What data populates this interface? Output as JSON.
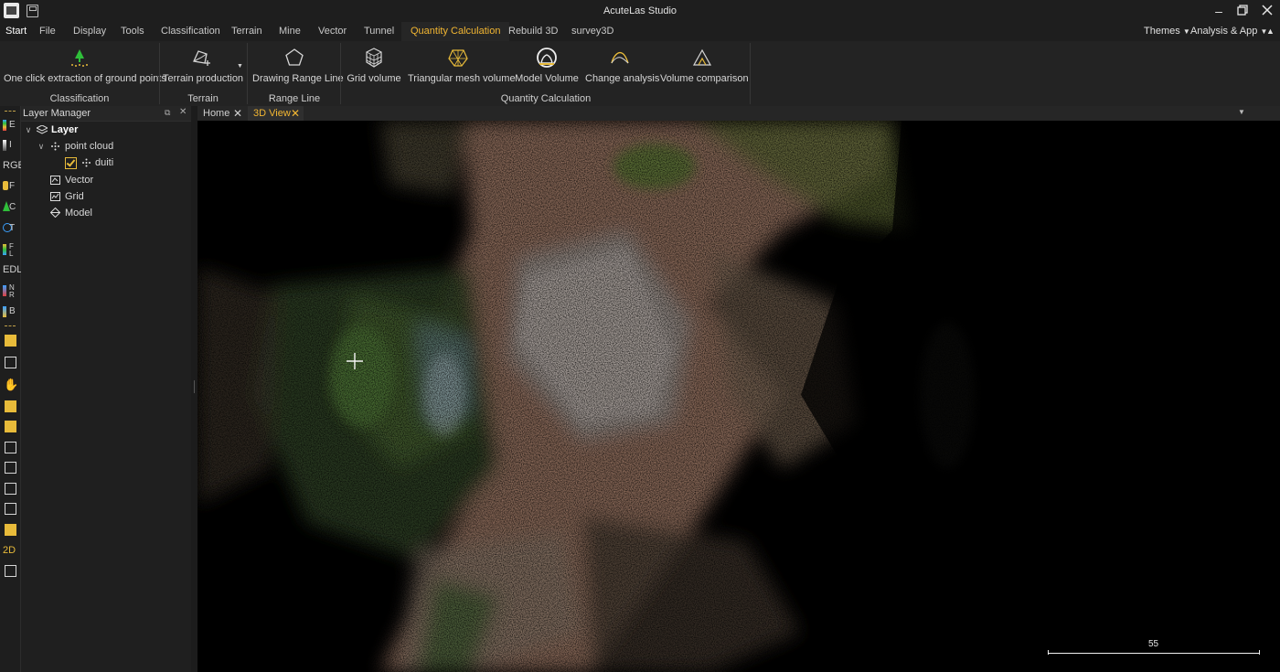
{
  "app": {
    "title": "AcuteLas Studio"
  },
  "menu": {
    "start": "Start",
    "items": [
      "File",
      "Display",
      "Tools",
      "Classification",
      "Terrain",
      "Mine",
      "Vector",
      "Tunnel",
      "Quantity Calculation",
      "Rebuild 3D",
      "survey3D"
    ],
    "active": "Quantity Calculation",
    "themes": "Themes",
    "analysis": "Analysis & App"
  },
  "ribbon": {
    "buttons": {
      "ground": "One click extraction of ground points",
      "terrain": "Terrain production",
      "range_line": "Drawing Range Line",
      "grid_volume": "Grid volume",
      "tri_volume": "Triangular mesh volume",
      "model_volume": "Model Volume",
      "change": "Change analysis",
      "volume_cmp": "Volume comparison"
    },
    "groups": {
      "classification": "Classification",
      "terrain": "Terrain",
      "range_line": "Range Line",
      "quantity": "Quantity Calculation"
    }
  },
  "left_toolbar": {
    "labels": [
      "E",
      "I",
      "RGB",
      "F",
      "C",
      "T",
      "F L",
      "EDL",
      "N R",
      "B",
      "2D"
    ]
  },
  "layer_manager": {
    "title": "Layer Manager",
    "root": "Layer",
    "point_cloud": "point cloud",
    "duiti": "duiti",
    "vector": "Vector",
    "grid": "Grid",
    "model": "Model"
  },
  "tabs": [
    "Home",
    "3D View"
  ],
  "viewport": {
    "scale_value": "55"
  },
  "colors": {
    "accent": "#f2b632",
    "background": "#000000",
    "panel": "#1f1f1f"
  }
}
